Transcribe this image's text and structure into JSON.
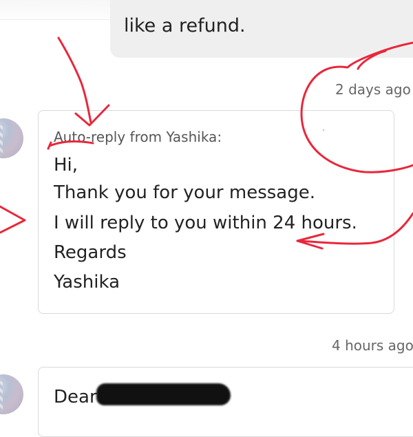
{
  "conversation": {
    "previous_message": {
      "text": "like a refund."
    },
    "auto_reply": {
      "timestamp": "2 days ago",
      "header": "Auto-reply from Yashika:",
      "lines": [
        "Hi,",
        "Thank you for your message.",
        "I will reply to you within 24 hours.",
        "Regards",
        "Yashika"
      ]
    },
    "next_message": {
      "timestamp": "4 hours ago",
      "greeting": "Dear "
    }
  },
  "colors": {
    "annotation": "#e8273b",
    "bubble_gray": "#efefef",
    "card_border": "#d9d9d9",
    "muted_text": "#666666"
  },
  "icons": {
    "avatar": "user-avatar",
    "redaction": "scribble-redaction"
  }
}
